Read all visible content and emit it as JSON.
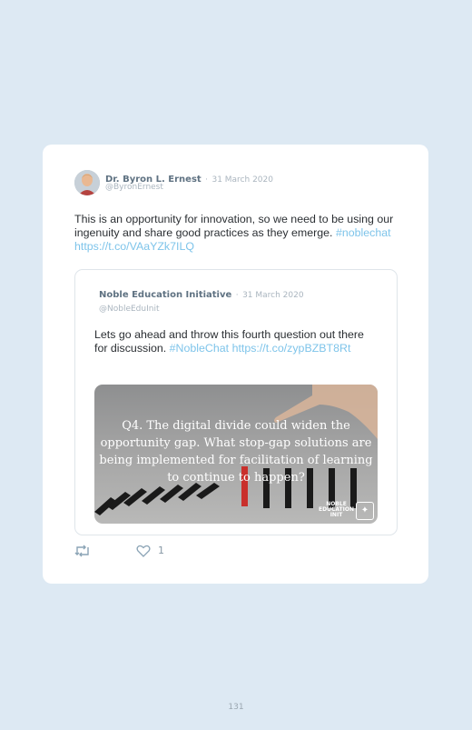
{
  "tweet": {
    "author_name": "Dr. Byron L. Ernest",
    "separator": "·",
    "date": "31 March 2020",
    "handle": "@ByronErnest",
    "text_plain": "This is an opportunity for innovation, so we need to be using our ingenuity and share good practices as they emerge.",
    "hashtag": "#noblechat",
    "link": "https://t.co/VAaYZk7ILQ"
  },
  "quoted_tweet": {
    "author_name": "Noble Education Initiative",
    "separator": "·",
    "date": "31 March 2020",
    "handle": "@NobleEduInit",
    "text_plain": "Lets go ahead and throw this fourth question out there for discussion.",
    "hashtag": "#NobleChat",
    "link": "https://t.co/zypBZBT8Rt",
    "image": {
      "caption": "Q4. The digital divide could widen the opportunity gap. What stop-gap solutions are being implemented for facilitation of learning to continue to happen?",
      "badge_line1": "NOBLE",
      "badge_line2": "EDUCATION",
      "badge_line3": "INIT"
    }
  },
  "actions": {
    "retweet_icon": "retweet-icon",
    "like_icon": "heart-icon",
    "like_count": "1"
  },
  "page_number": "131",
  "colors": {
    "background": "#dde9f3",
    "link": "#7ec4ea",
    "author": "#5f7282",
    "meta": "#aab5bf"
  }
}
